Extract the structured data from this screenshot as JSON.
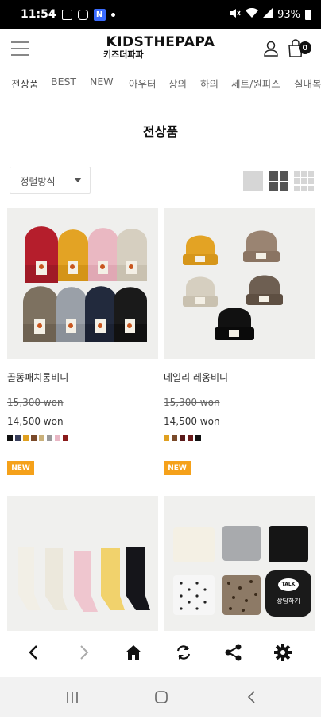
{
  "status": {
    "time": "11:54",
    "n_label": "N",
    "battery": "93%"
  },
  "header": {
    "logo_en": "KIDSTHEPAPA",
    "logo_ko": "키즈더파파",
    "cart_count": "0"
  },
  "categories": [
    "전상품",
    "BEST",
    "NEW",
    "아우터",
    "상의",
    "하의",
    "세트/원피스",
    "실내복"
  ],
  "page_title": "전상품",
  "sort": {
    "label": "-정렬방식-"
  },
  "products": [
    {
      "name": "골똥패치롱비니",
      "orig_price": "15,300 won",
      "price": "14,500 won",
      "badge": "NEW",
      "swatches": [
        "#111111",
        "#3a3f5c",
        "#e0a020",
        "#7a4a2a",
        "#c9b07a",
        "#999999",
        "#e8b6c4",
        "#8a1a1a"
      ]
    },
    {
      "name": "데일리 레옹비니",
      "orig_price": "15,300 won",
      "price": "14,500 won",
      "badge": "NEW",
      "swatches": [
        "#e0a020",
        "#7a4a2a",
        "#5a1a1a",
        "#6a1a1a",
        "#111111"
      ]
    },
    {
      "name": "",
      "orig_price": "",
      "price": "",
      "badge": "",
      "swatches": []
    },
    {
      "name": "",
      "orig_price": "",
      "price": "",
      "badge": "",
      "swatches": []
    }
  ],
  "chat": {
    "talk": "TALK",
    "label": "상담하기"
  },
  "colors": {
    "accent_new": "#f5a11a",
    "status_bar": "#000000"
  }
}
